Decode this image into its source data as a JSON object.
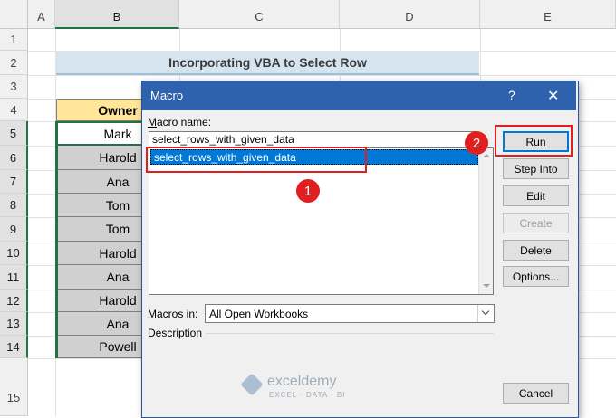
{
  "columns": [
    "A",
    "B",
    "C",
    "D",
    "E"
  ],
  "rows": [
    "1",
    "2",
    "3",
    "4",
    "5",
    "6",
    "7",
    "8",
    "9",
    "10",
    "11",
    "12",
    "13",
    "14",
    "15"
  ],
  "sheet": {
    "title": "Incorporating VBA to Select Row",
    "owner_header": "Owner",
    "owners": [
      "Mark",
      "Harold",
      "Ana",
      "Tom",
      "Tom",
      "Harold",
      "Ana",
      "Harold",
      "Ana",
      "Powell"
    ]
  },
  "dialog": {
    "title": "Macro",
    "help": "?",
    "close": "✕",
    "macro_name_label": "Macro name:",
    "macro_name_value": "select_rows_with_given_data",
    "macros_list": [
      "select_rows_with_given_data"
    ],
    "buttons": {
      "run": "Run",
      "step_into": "Step Into",
      "edit": "Edit",
      "create": "Create",
      "delete": "Delete",
      "options": "Options...",
      "cancel": "Cancel"
    },
    "macros_in_label": "Macros in:",
    "macros_in_value": "All Open Workbooks",
    "description_label": "Description"
  },
  "badges": {
    "one": "1",
    "two": "2"
  },
  "watermark": {
    "brand": "exceldemy",
    "tagline": "EXCEL · DATA · BI"
  },
  "colors": {
    "title_bar": "#2f62ad",
    "highlight": "#e02020",
    "selection": "#0078d7",
    "excel_green": "#217346"
  }
}
